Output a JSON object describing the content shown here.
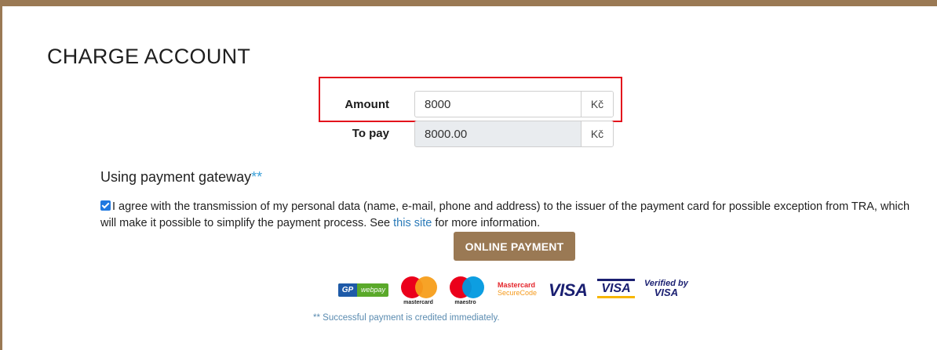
{
  "page": {
    "title": "CHARGE ACCOUNT"
  },
  "form": {
    "amount": {
      "label": "Amount",
      "value": "8000",
      "currency": "Kč"
    },
    "to_pay": {
      "label": "To pay",
      "value": "8000.00",
      "currency": "Kč"
    }
  },
  "gateway": {
    "heading": "Using payment gateway",
    "heading_mark": "**",
    "consent": {
      "checked": true,
      "text_before": "I agree with the transmission of my personal data (name, e-mail, phone and address) to the issuer of the payment card for possible exception from TRA, which will make it possible to simplify the payment process. See ",
      "link_text": "this site",
      "text_after": " for more information."
    },
    "button_label": "ONLINE PAYMENT",
    "logos": {
      "gp_left": "GP",
      "gp_right": "webpay",
      "mastercard": "mastercard",
      "maestro": "maestro",
      "mc_securecode_1": "Mastercard",
      "mc_securecode_2": "SecureCode",
      "visa": "VISA",
      "visa_electron": "VISA",
      "verified_1": "Verified by",
      "verified_2": "VISA"
    },
    "footnote": "** Successful payment is credited immediately."
  },
  "colors": {
    "brand": "#9a7954",
    "highlight": "#e3121c",
    "link": "#2a7ab8",
    "checkbox": "#1f78e0"
  }
}
